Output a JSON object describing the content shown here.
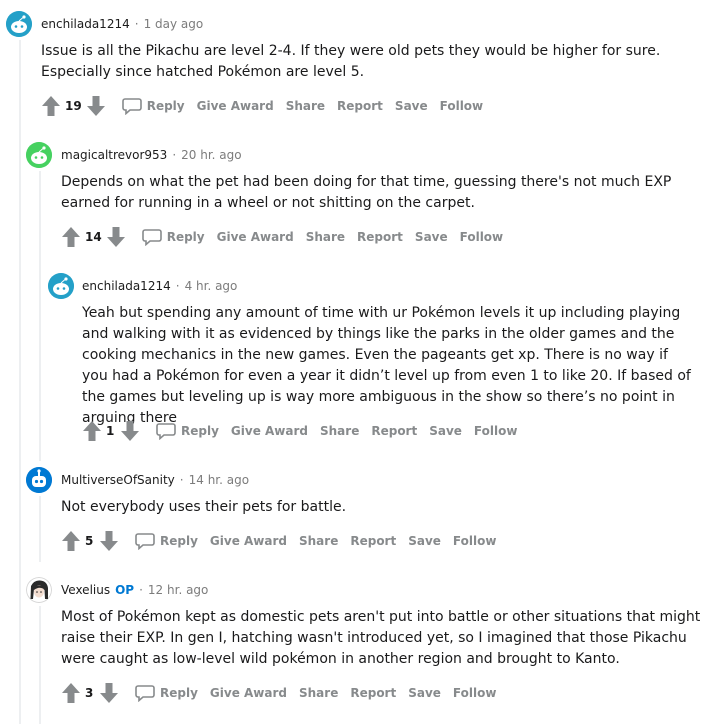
{
  "actions": {
    "reply": "Reply",
    "give_award": "Give Award",
    "share": "Share",
    "report": "Report",
    "save": "Save",
    "follow": "Follow"
  },
  "comments": [
    {
      "username": "enchilada1214",
      "time": "1 day ago",
      "body": "Issue is all the Pikachu are level 2-4. If they were old pets they would be higher for sure. Especially since hatched Pokémon are level 5.",
      "score": "19"
    },
    {
      "username": "magicaltrevor953",
      "time": "20 hr. ago",
      "body": "Depends on what the pet had been doing for that time, guessing there's not much EXP earned for running in a wheel or not shitting on the carpet.",
      "score": "14"
    },
    {
      "username": "enchilada1214",
      "time": "4 hr. ago",
      "body": "Yeah but spending any amount of time with ur Pokémon levels it up including playing and walking with it as evidenced by things like the parks in the older games and the cooking mechanics in the new games. Even the pageants get xp. There is no way if you had a Pokémon for even a year it didn’t level up from even 1 to like 20. If based of the games but leveling up is way more ambiguous in the show so there’s no point in arguing there",
      "score": "1"
    },
    {
      "username": "MultiverseOfSanity",
      "time": "14 hr. ago",
      "body": "Not everybody uses their pets for battle.",
      "score": "5"
    },
    {
      "username": "Vexelius",
      "op_badge": "OP",
      "time": "12 hr. ago",
      "body": "Most of Pokémon kept as domestic pets aren't put into battle or other situations that might raise their EXP. In gen I, hatching wasn't introduced yet, so I imagined that those Pikachu were caught as low-level wild pokémon in another region and brought to Kanto.",
      "score": "3"
    }
  ],
  "colors": {
    "avatar_teal": "#24a0c8",
    "avatar_green": "#46d160",
    "avatar_blue": "#0079d3",
    "op_blue": "#0079d3",
    "action_gray": "#878a8c",
    "meta_gray": "#7c7c7c"
  }
}
